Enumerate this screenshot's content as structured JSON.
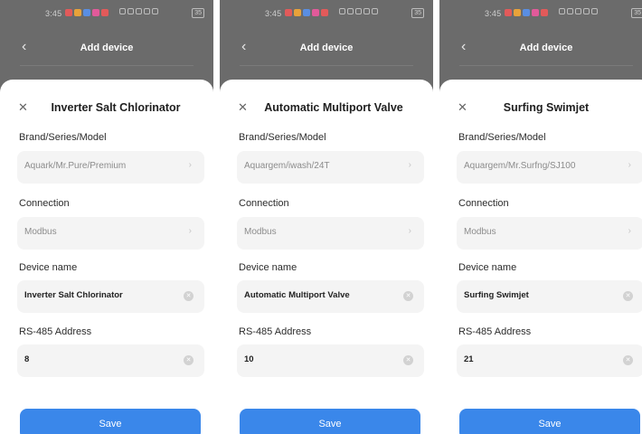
{
  "status_bar": {
    "time": "3:45",
    "battery": "35",
    "notification_colors": [
      "#e25a5a",
      "#e8a23a",
      "#5a8ee2",
      "#e25a9a",
      "#e25a5a"
    ]
  },
  "screens": [
    {
      "nav_title": "Add device",
      "sheet_title": "Inverter Salt Chlorinator",
      "fields": {
        "brand_label": "Brand/Series/Model",
        "brand_value": "Aquark/Mr.Pure/Premium",
        "connection_label": "Connection",
        "connection_value": "Modbus",
        "device_name_label": "Device name",
        "device_name_value": "Inverter Salt Chlorinator",
        "address_label": "RS-485 Address",
        "address_value": "8"
      },
      "save_label": "Save"
    },
    {
      "nav_title": "Add device",
      "sheet_title": "Automatic Multiport Valve",
      "fields": {
        "brand_label": "Brand/Series/Model",
        "brand_value": "Aquargem/iwash/24T",
        "connection_label": "Connection",
        "connection_value": "Modbus",
        "device_name_label": "Device name",
        "device_name_value": "Automatic Multiport Valve",
        "address_label": "RS-485 Address",
        "address_value": "10"
      },
      "save_label": "Save"
    },
    {
      "nav_title": "Add device",
      "sheet_title": "Surfing Swimjet",
      "fields": {
        "brand_label": "Brand/Series/Model",
        "brand_value": "Aquargem/Mr.Surfng/SJ100",
        "connection_label": "Connection",
        "connection_value": "Modbus",
        "device_name_label": "Device name",
        "device_name_value": "Surfing Swimjet",
        "address_label": "RS-485 Address",
        "address_value": "21"
      },
      "save_label": "Save"
    }
  ],
  "icons": {
    "back": "chevron-left-icon",
    "close": "close-icon",
    "chevron": "chevron-right-icon",
    "clear": "clear-icon"
  },
  "colors": {
    "accent": "#3a87ea",
    "overlay": "#6b6b6b",
    "field_bg": "#f4f4f4"
  }
}
